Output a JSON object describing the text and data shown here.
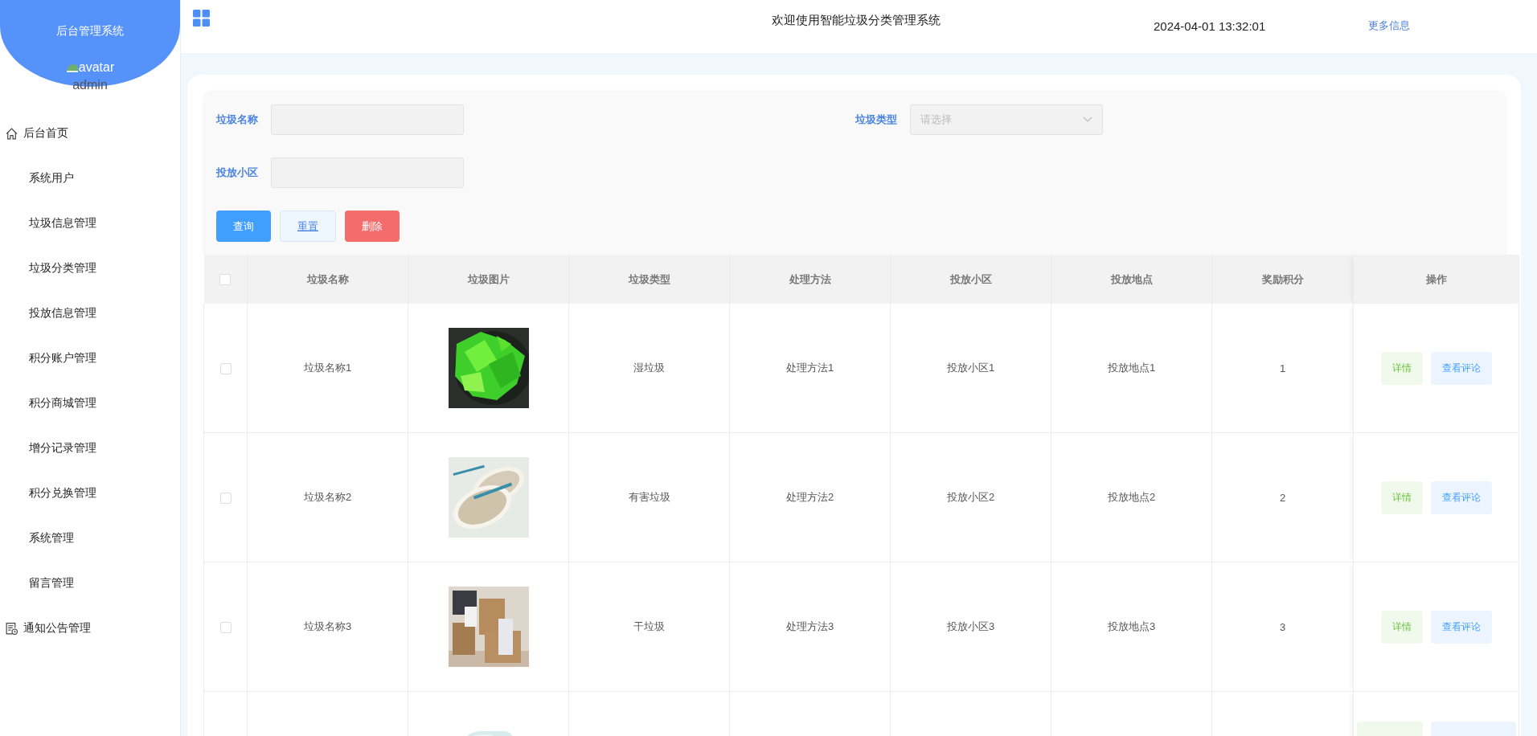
{
  "sidebar": {
    "title": "后台管理系统",
    "avatar_alt": "avatar",
    "username": "admin",
    "items": [
      {
        "label": "后台首页",
        "kind": "home"
      },
      {
        "label": "系统用户",
        "kind": "plain"
      },
      {
        "label": "垃圾信息管理",
        "kind": "plain"
      },
      {
        "label": "垃圾分类管理",
        "kind": "plain"
      },
      {
        "label": "投放信息管理",
        "kind": "plain"
      },
      {
        "label": "积分账户管理",
        "kind": "plain"
      },
      {
        "label": "积分商城管理",
        "kind": "plain"
      },
      {
        "label": "增分记录管理",
        "kind": "plain"
      },
      {
        "label": "积分兑换管理",
        "kind": "plain"
      },
      {
        "label": "系统管理",
        "kind": "plain"
      },
      {
        "label": "留言管理",
        "kind": "plain"
      },
      {
        "label": "通知公告管理",
        "kind": "notice"
      }
    ]
  },
  "header": {
    "title": "欢迎使用智能垃圾分类管理系统",
    "datetime": "2024-04-01 13:32:01",
    "more_link": "更多信息"
  },
  "search": {
    "name_label": "垃圾名称",
    "type_label": "垃圾类型",
    "type_placeholder": "请选择",
    "district_label": "投放小区",
    "buttons": [
      {
        "label": "查询",
        "kind": "primary"
      },
      {
        "label": "重置",
        "kind": "plain"
      },
      {
        "label": "删除",
        "kind": "danger"
      }
    ]
  },
  "table": {
    "all_checked": false,
    "columns": [
      "垃圾名称",
      "垃圾图片",
      "垃圾类型",
      "处理方法",
      "投放小区",
      "投放地点",
      "奖励积分",
      "操作"
    ],
    "rows": [
      {
        "checked": false,
        "name": "垃圾名称1",
        "image": {
          "kind": "picture"
        },
        "type": "湿垃圾",
        "method": "处理方法1",
        "district": "投放小区1",
        "location": "投放地点1",
        "points": "1",
        "actions": [
          "详情",
          "查看评论"
        ]
      },
      {
        "checked": false,
        "name": "垃圾名称2",
        "image": {
          "kind": "picture"
        },
        "type": "有害垃圾",
        "method": "处理方法2",
        "district": "投放小区2",
        "location": "投放地点2",
        "points": "2",
        "actions": [
          "详情",
          "查看评论"
        ]
      },
      {
        "checked": false,
        "name": "垃圾名称3",
        "image": {
          "kind": "picture"
        },
        "type": "干垃圾",
        "method": "处理方法3",
        "district": "投放小区3",
        "location": "投放地点3",
        "points": "3",
        "actions": [
          "详情",
          "查看评论"
        ]
      }
    ],
    "partial_row": {
      "image": {
        "kind": "picture"
      }
    }
  }
}
